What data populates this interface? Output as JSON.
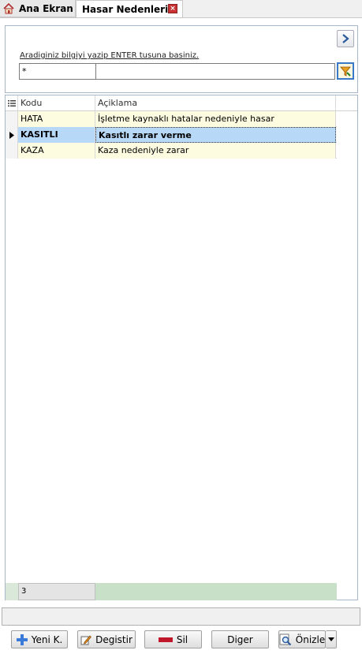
{
  "tabs": {
    "home_label": "Ana Ekran",
    "active_label": "Hasar Nedenleri",
    "close_glyph": "×"
  },
  "search": {
    "hint": "Aradiginiz bilgiyi yazip ENTER tusuna basiniz.",
    "value": "*",
    "value2": ""
  },
  "grid": {
    "headers": {
      "kodu": "Kodu",
      "aciklama": "Açiklama"
    },
    "rows": [
      {
        "kodu": "HATA",
        "aciklama": "İşletme kaynaklı hatalar nedeniyle hasar"
      },
      {
        "kodu": "KASITLI",
        "aciklama": "Kasıtlı zarar verme"
      },
      {
        "kodu": "KAZA",
        "aciklama": "Kaza nedeniyle zarar"
      }
    ],
    "selected_index": 1,
    "count": "3"
  },
  "buttons": {
    "yeni": "Yeni K.",
    "degistir": "Degistir",
    "sil": "Sil",
    "diger": "Diger",
    "onizle": "Önizle"
  },
  "colors": {
    "row_bg": "#fdfbe0",
    "selected_bg": "#b8d8f8",
    "footer_green": "#c8e0c8"
  },
  "icons": {
    "home": "home-icon",
    "next": "chevron-right-icon",
    "filter": "filter-icon",
    "add": "plus-icon",
    "edit": "pencil-icon",
    "delete": "minus-icon",
    "preview": "magnifier-icon"
  }
}
